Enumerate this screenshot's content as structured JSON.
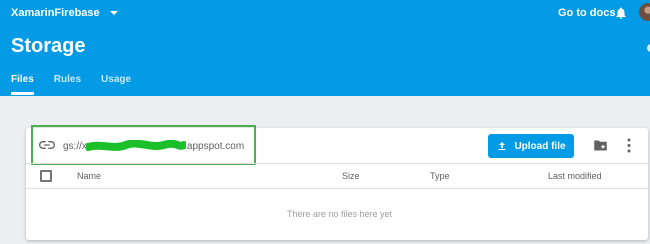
{
  "header": {
    "project_name": "XamarinFirebase",
    "docs_link": "Go to docs",
    "page_title": "Storage",
    "tabs": [
      {
        "label": "Files",
        "active": true
      },
      {
        "label": "Rules",
        "active": false
      },
      {
        "label": "Usage",
        "active": false
      }
    ],
    "colors": {
      "brand": "#039be5"
    }
  },
  "storage": {
    "bucket_url_prefix": "gs://x",
    "bucket_url_suffix": "appspot.com",
    "upload_label": "Upload file",
    "highlight_color": "#4caf50",
    "columns": [
      "Name",
      "Size",
      "Type",
      "Last modified"
    ],
    "empty_message": "There are no files here yet"
  },
  "icons": [
    "chevron-down-icon",
    "bell-icon",
    "link-icon",
    "upload-icon",
    "new-folder-icon",
    "more-vert-icon"
  ]
}
